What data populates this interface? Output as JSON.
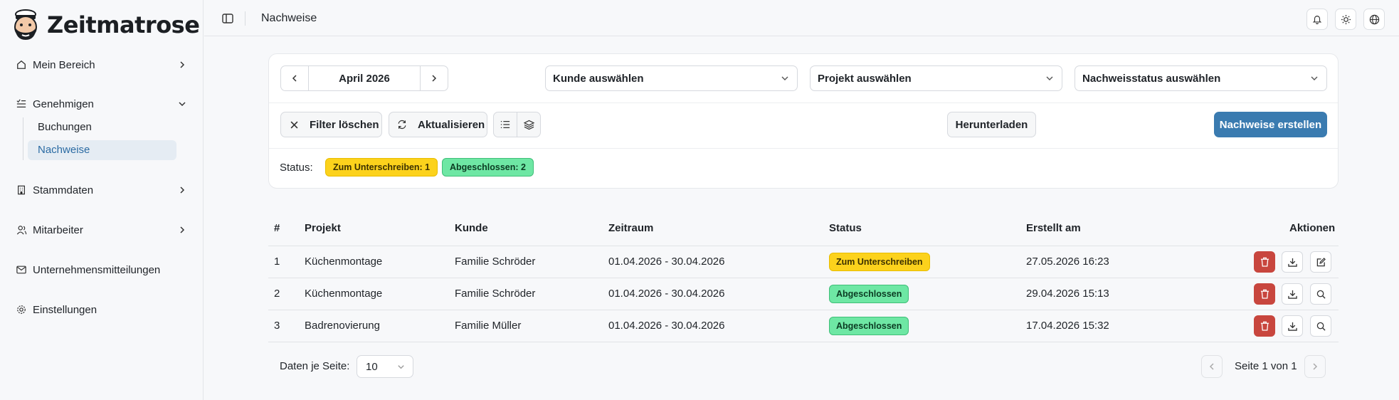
{
  "app": {
    "name": "Zeitmatrose"
  },
  "sidebar": {
    "items": [
      {
        "label": "Mein Bereich",
        "icon": "home-icon"
      },
      {
        "label": "Genehmigen",
        "icon": "list-check-icon",
        "expanded": true,
        "children": [
          {
            "label": "Buchungen"
          },
          {
            "label": "Nachweise",
            "active": true
          }
        ]
      },
      {
        "label": "Stammdaten",
        "icon": "building-icon"
      },
      {
        "label": "Mitarbeiter",
        "icon": "users-icon"
      },
      {
        "label": "Unternehmensmitteilungen",
        "icon": "mail-icon"
      },
      {
        "label": "Einstellungen",
        "icon": "gear-icon"
      }
    ]
  },
  "header": {
    "title": "Nachweise"
  },
  "filters": {
    "month": "April 2026",
    "customer_select": "Kunde auswählen",
    "project_select": "Projekt auswählen",
    "status_select": "Nachweisstatus auswählen",
    "clear_label": "Filter löschen",
    "refresh_label": "Aktualisieren",
    "download_label": "Herunterladen",
    "create_label": "Nachweise erstellen",
    "status_label": "Status:",
    "status_counts": [
      {
        "label": "Zum Unterschreiben: 1",
        "color": "#fcd21c"
      },
      {
        "label": "Abgeschlossen: 2",
        "color": "#6ee7a4"
      }
    ]
  },
  "table": {
    "headers": [
      "#",
      "Projekt",
      "Kunde",
      "Zeitraum",
      "Status",
      "Erstellt am",
      "Aktionen"
    ],
    "rows": [
      {
        "num": "1",
        "project": "Küchenmontage",
        "customer": "Familie Schröder",
        "period": "01.04.2026 - 30.04.2026",
        "status": "Zum Unterschreiben",
        "created": "27.05.2026 16:23"
      },
      {
        "num": "2",
        "project": "Küchenmontage",
        "customer": "Familie Schröder",
        "period": "01.04.2026 - 30.04.2026",
        "status": "Abgeschlossen",
        "created": "29.04.2026 15:13"
      },
      {
        "num": "3",
        "project": "Badrenovierung",
        "customer": "Familie Müller",
        "period": "01.04.2026 - 30.04.2026",
        "status": "Abgeschlossen",
        "created": "17.04.2026 15:32"
      }
    ]
  },
  "pagination": {
    "per_page_label": "Daten je Seite:",
    "per_page": "10",
    "page_text": "Seite 1 von 1"
  },
  "colors": {
    "primary": "#3a7bb0",
    "danger": "#c8463e",
    "pending": "#fcd21c",
    "done": "#6ee7a4",
    "active_nav": "#e5ecf3"
  }
}
